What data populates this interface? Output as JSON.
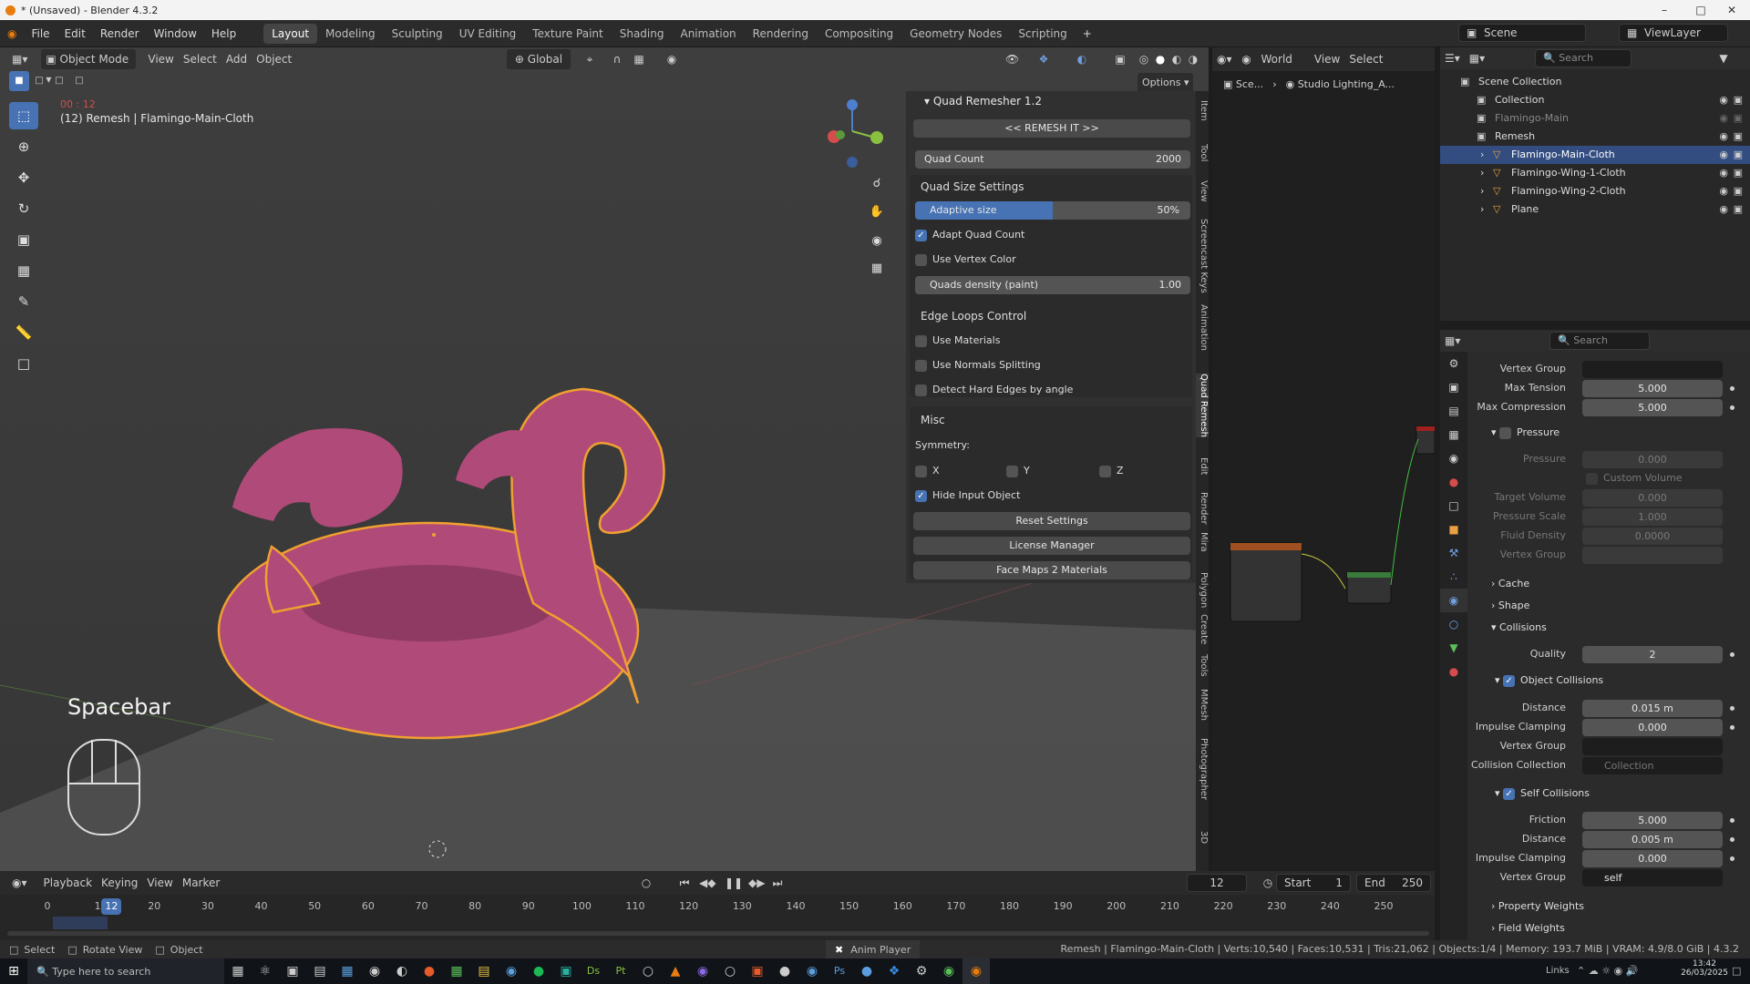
{
  "window": {
    "title": "* (Unsaved) - Blender 4.3.2"
  },
  "menus": [
    "File",
    "Edit",
    "Render",
    "Window",
    "Help"
  ],
  "workspaces": [
    {
      "label": "Layout",
      "active": true
    },
    {
      "label": "Modeling"
    },
    {
      "label": "Sculpting"
    },
    {
      "label": "UV Editing"
    },
    {
      "label": "Texture Paint"
    },
    {
      "label": "Shading"
    },
    {
      "label": "Animation"
    },
    {
      "label": "Rendering"
    },
    {
      "label": "Compositing"
    },
    {
      "label": "Geometry Nodes"
    },
    {
      "label": "Scripting"
    }
  ],
  "scene": {
    "name": "Scene",
    "viewlayer": "ViewLayer"
  },
  "viewport": {
    "mode": "Object Mode",
    "menus": [
      "View",
      "Select",
      "Add",
      "Object"
    ],
    "transform": "Global",
    "options": "Options",
    "object_label": "(12) Remesh | Flamingo-Main-Cloth",
    "time_label": "00 : 12",
    "key_overlay": "Spacebar"
  },
  "quad_remesher": {
    "title": "Quad Remesher 1.2",
    "remesh_button": "<< REMESH IT >>",
    "quad_count": {
      "label": "Quad Count",
      "value": "2000"
    },
    "quad_size_header": "Quad Size Settings",
    "adaptive": {
      "label": "Adaptive size",
      "value": "50%",
      "fraction": 0.5
    },
    "adapt_quad_count": {
      "label": "Adapt Quad Count",
      "checked": true
    },
    "use_vertex_color": {
      "label": "Use Vertex Color",
      "checked": false
    },
    "quads_density": {
      "label": "Quads density (paint)",
      "value": "1.00"
    },
    "edge_loops_header": "Edge Loops Control",
    "use_materials": "Use Materials",
    "use_normals": "Use Normals Splitting",
    "detect_hard": "Detect Hard Edges by angle",
    "misc_header": "Misc",
    "symmetry": "Symmetry:",
    "sym_x": "X",
    "sym_y": "Y",
    "sym_z": "Z",
    "hide_input": {
      "label": "Hide Input Object",
      "checked": true
    },
    "reset": "Reset Settings",
    "license": "License Manager",
    "facemaps": "Face Maps 2 Materials"
  },
  "side_tabs": [
    "Item",
    "Tool",
    "View",
    "Screencast Keys",
    "Animation",
    "Quad Remesh",
    "Edit",
    "Render",
    "Mira",
    "Polygon",
    "Create",
    "Tools",
    "MMesh",
    "Photographer",
    "3D"
  ],
  "node_editor": {
    "world": "World",
    "menus": [
      "View",
      "Select"
    ],
    "breadcrumb_scene": "Sce...",
    "breadcrumb_world": "Studio Lighting_A..."
  },
  "outliner": {
    "search_placeholder": "Search",
    "items": [
      {
        "label": "Scene Collection",
        "indent": 0
      },
      {
        "label": "Collection",
        "indent": 1
      },
      {
        "label": "Flamingo-Main",
        "indent": 1,
        "dim": true
      },
      {
        "label": "Remesh",
        "indent": 1
      },
      {
        "label": "Flamingo-Main-Cloth",
        "indent": 2,
        "selected": true
      },
      {
        "label": "Flamingo-Wing-1-Cloth",
        "indent": 2
      },
      {
        "label": "Flamingo-Wing-2-Cloth",
        "indent": 2
      },
      {
        "label": "Plane",
        "indent": 2
      }
    ]
  },
  "properties": {
    "search_placeholder": "Search",
    "vertex_group": "Vertex Group",
    "max_tension": {
      "label": "Max Tension",
      "value": "5.000"
    },
    "max_compression": {
      "label": "Max Compression",
      "value": "5.000"
    },
    "pressure_header": "Pressure",
    "pressure": {
      "label": "Pressure",
      "value": "0.000"
    },
    "custom_volume": "Custom Volume",
    "target_volume": {
      "label": "Target Volume",
      "value": "0.000"
    },
    "pressure_scale": {
      "label": "Pressure Scale",
      "value": "1.000"
    },
    "fluid_density": {
      "label": "Fluid Density",
      "value": "0.0000"
    },
    "vertex_group2": "Vertex Group",
    "cache": "Cache",
    "shape": "Shape",
    "collisions": "Collisions",
    "quality": {
      "label": "Quality",
      "value": "2"
    },
    "object_collisions": "Object Collisions",
    "distance": {
      "label": "Distance",
      "value": "0.015 m"
    },
    "impulse": {
      "label": "Impulse Clamping",
      "value": "0.000"
    },
    "vertex_group3": "Vertex Group",
    "collision_collection": {
      "label": "Collision Collection",
      "placeholder": "Collection"
    },
    "self_collisions": "Self Collisions",
    "friction": {
      "label": "Friction",
      "value": "5.000"
    },
    "distance2": {
      "label": "Distance",
      "value": "0.005 m"
    },
    "impulse2": {
      "label": "Impulse Clamping",
      "value": "0.000"
    },
    "vertex_group4": {
      "label": "Vertex Group",
      "value": "self"
    },
    "property_weights": "Property Weights",
    "field_weights": "Field Weights"
  },
  "timeline": {
    "menus": [
      "Playback",
      "Keying",
      "View",
      "Marker"
    ],
    "current_frame": "12",
    "start_label": "Start",
    "start": "1",
    "end_label": "End",
    "end": "250",
    "ticks": [
      "0",
      "10",
      "20",
      "30",
      "40",
      "50",
      "60",
      "70",
      "80",
      "90",
      "100",
      "110",
      "120",
      "130",
      "140",
      "150",
      "160",
      "170",
      "180",
      "190",
      "200",
      "210",
      "220",
      "230",
      "240",
      "250"
    ]
  },
  "status": {
    "select": "Select",
    "rotate": "Rotate View",
    "object": "Object",
    "anim_player": "Anim Player",
    "stats": "Remesh | Flamingo-Main-Cloth | Verts:10,540 | Faces:10,531 | Tris:21,062 | Objects:1/4 | Memory: 193.7 MiB | VRAM: 4.9/8.0 GiB | 4.3.2"
  },
  "taskbar": {
    "search_placeholder": "Type here to search",
    "time": "13:42",
    "date": "26/03/2025",
    "links": "Links"
  },
  "colors": {
    "accent": "#4772b3",
    "selection": "#f0a030",
    "flamingo": "#b04a78"
  }
}
